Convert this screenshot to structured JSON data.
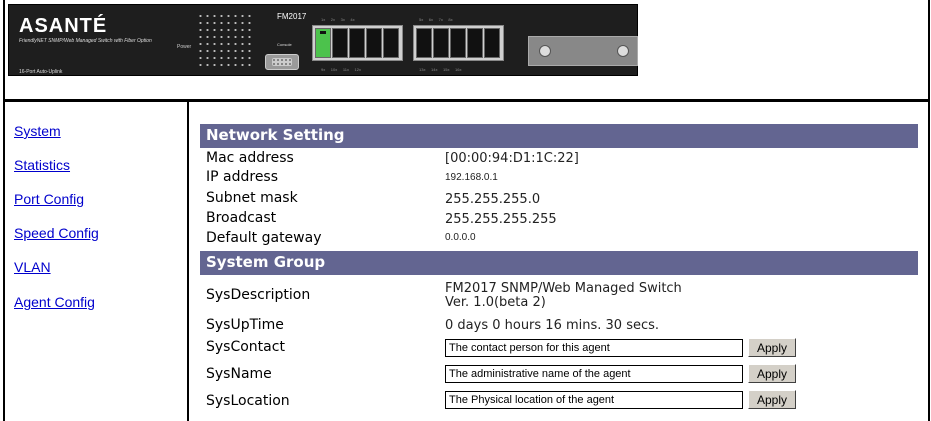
{
  "header": {
    "brand": "ASANTÉ",
    "brand_subtitle": "FriendlyNET SNMP/Web Managed Switch with Fiber Option",
    "brand_footer": "16-Port Auto-Uplink",
    "model": "FM2017",
    "power_label": "Power",
    "console_label": "Console",
    "ports_top": [
      "1x",
      "2x",
      "3x",
      "4x",
      "5x",
      "6x",
      "7x",
      "8x"
    ],
    "ports_bottom": [
      "9x",
      "10x",
      "11x",
      "12x",
      "13x",
      "14x",
      "15x",
      "16x"
    ]
  },
  "sidebar": {
    "items": [
      {
        "label": "System"
      },
      {
        "label": "Statistics"
      },
      {
        "label": "Port Config"
      },
      {
        "label": "Speed Config"
      },
      {
        "label": "VLAN"
      },
      {
        "label": "Agent Config"
      }
    ]
  },
  "network": {
    "title": "Network Setting",
    "rows": [
      {
        "label": "Mac address",
        "value": "[00:00:94:D1:1C:22]"
      },
      {
        "label": "IP address",
        "value": "192.168.0.1"
      },
      {
        "label": "Subnet mask",
        "value": "255.255.255.0"
      },
      {
        "label": "Broadcast",
        "value": "255.255.255.255"
      },
      {
        "label": "Default gateway",
        "value": "0.0.0.0"
      }
    ]
  },
  "system": {
    "title": "System Group",
    "description_label": "SysDescription",
    "description_line1": "FM2017 SNMP/Web Managed Switch",
    "description_line2": "Ver. 1.0(beta 2)",
    "uptime_label": "SysUpTime",
    "uptime_value": "0 days 0 hours 16 mins. 30 secs.",
    "contact_label": "SysContact",
    "contact_value": "The contact person for this agent",
    "name_label": "SysName",
    "name_value": "The administrative name of the agent",
    "location_label": "SysLocation",
    "location_value": "The Physical location of the agent",
    "apply_label": "Apply"
  }
}
